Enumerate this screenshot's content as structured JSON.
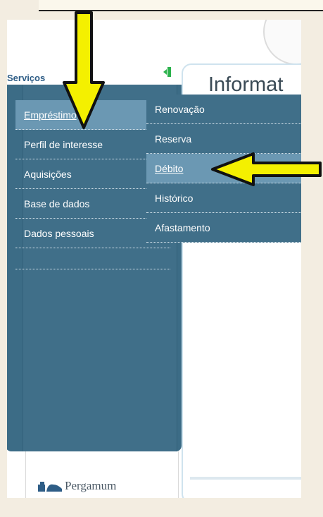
{
  "sidebar": {
    "title": "Serviços",
    "items": [
      {
        "label": "Empréstimo",
        "active": true
      },
      {
        "label": "Perfil de interesse",
        "active": false
      },
      {
        "label": "Aquisições",
        "active": false
      },
      {
        "label": "Base de dados",
        "active": false
      },
      {
        "label": "Dados pessoais",
        "active": false
      }
    ]
  },
  "submenu": {
    "items": [
      {
        "label": "Renovação",
        "active": false
      },
      {
        "label": "Reserva",
        "active": false
      },
      {
        "label": "Débito",
        "active": true
      },
      {
        "label": "Histórico",
        "active": false
      },
      {
        "label": "Afastamento",
        "active": false
      }
    ]
  },
  "content": {
    "heading": "Informat"
  },
  "footer": {
    "logo_text": "Pergamum"
  },
  "colors": {
    "sidebar_bg": "#3c6c86",
    "menu_active": "#6b98b3",
    "title_blue": "#2e5d86",
    "arrow_fill": "#f4f000",
    "exit_icon_green": "#2bb24c"
  },
  "icons": {
    "exit": "exit-icon",
    "arrow_down": "yellow-arrow-down-icon",
    "arrow_left": "yellow-arrow-left-icon",
    "logo": "pergamum-logo-icon"
  }
}
